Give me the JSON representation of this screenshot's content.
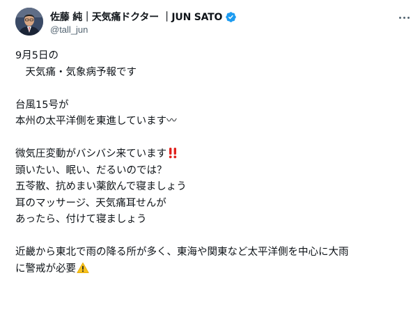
{
  "tweet": {
    "author": {
      "display_name": "佐藤 純｜天気痛ドクター ｜JUN SATO",
      "handle": "@tall_jun"
    },
    "lines": [
      "9月5日の",
      "　天気痛・気象病予報です",
      "",
      "台風15号が",
      "本州の太平洋側を東進しています〰",
      "",
      "微気圧変動がバシバシ来ています",
      "頭いたい、眠い、だるいのでは？",
      "五苓散、抗めまい薬飲んで寝ましょう",
      "耳のマッサージ、天気痛耳せんが",
      "あったら、付けて寝ましょう",
      "",
      "近畿から東北で雨の降る所が多く、東海や関東など太平洋側を中心に大雨",
      "に警戒が必要"
    ],
    "icons": {
      "verified": "verified-badge-icon",
      "more": "more-options-icon",
      "double_exclamation": "double-exclamation-emoji",
      "warning": "warning-emoji"
    },
    "colors": {
      "verified": "#1d9bf0",
      "handle": "#536471",
      "text": "#0f1419",
      "exclamation": "#e0201c",
      "warning": "#f8c21c"
    }
  }
}
